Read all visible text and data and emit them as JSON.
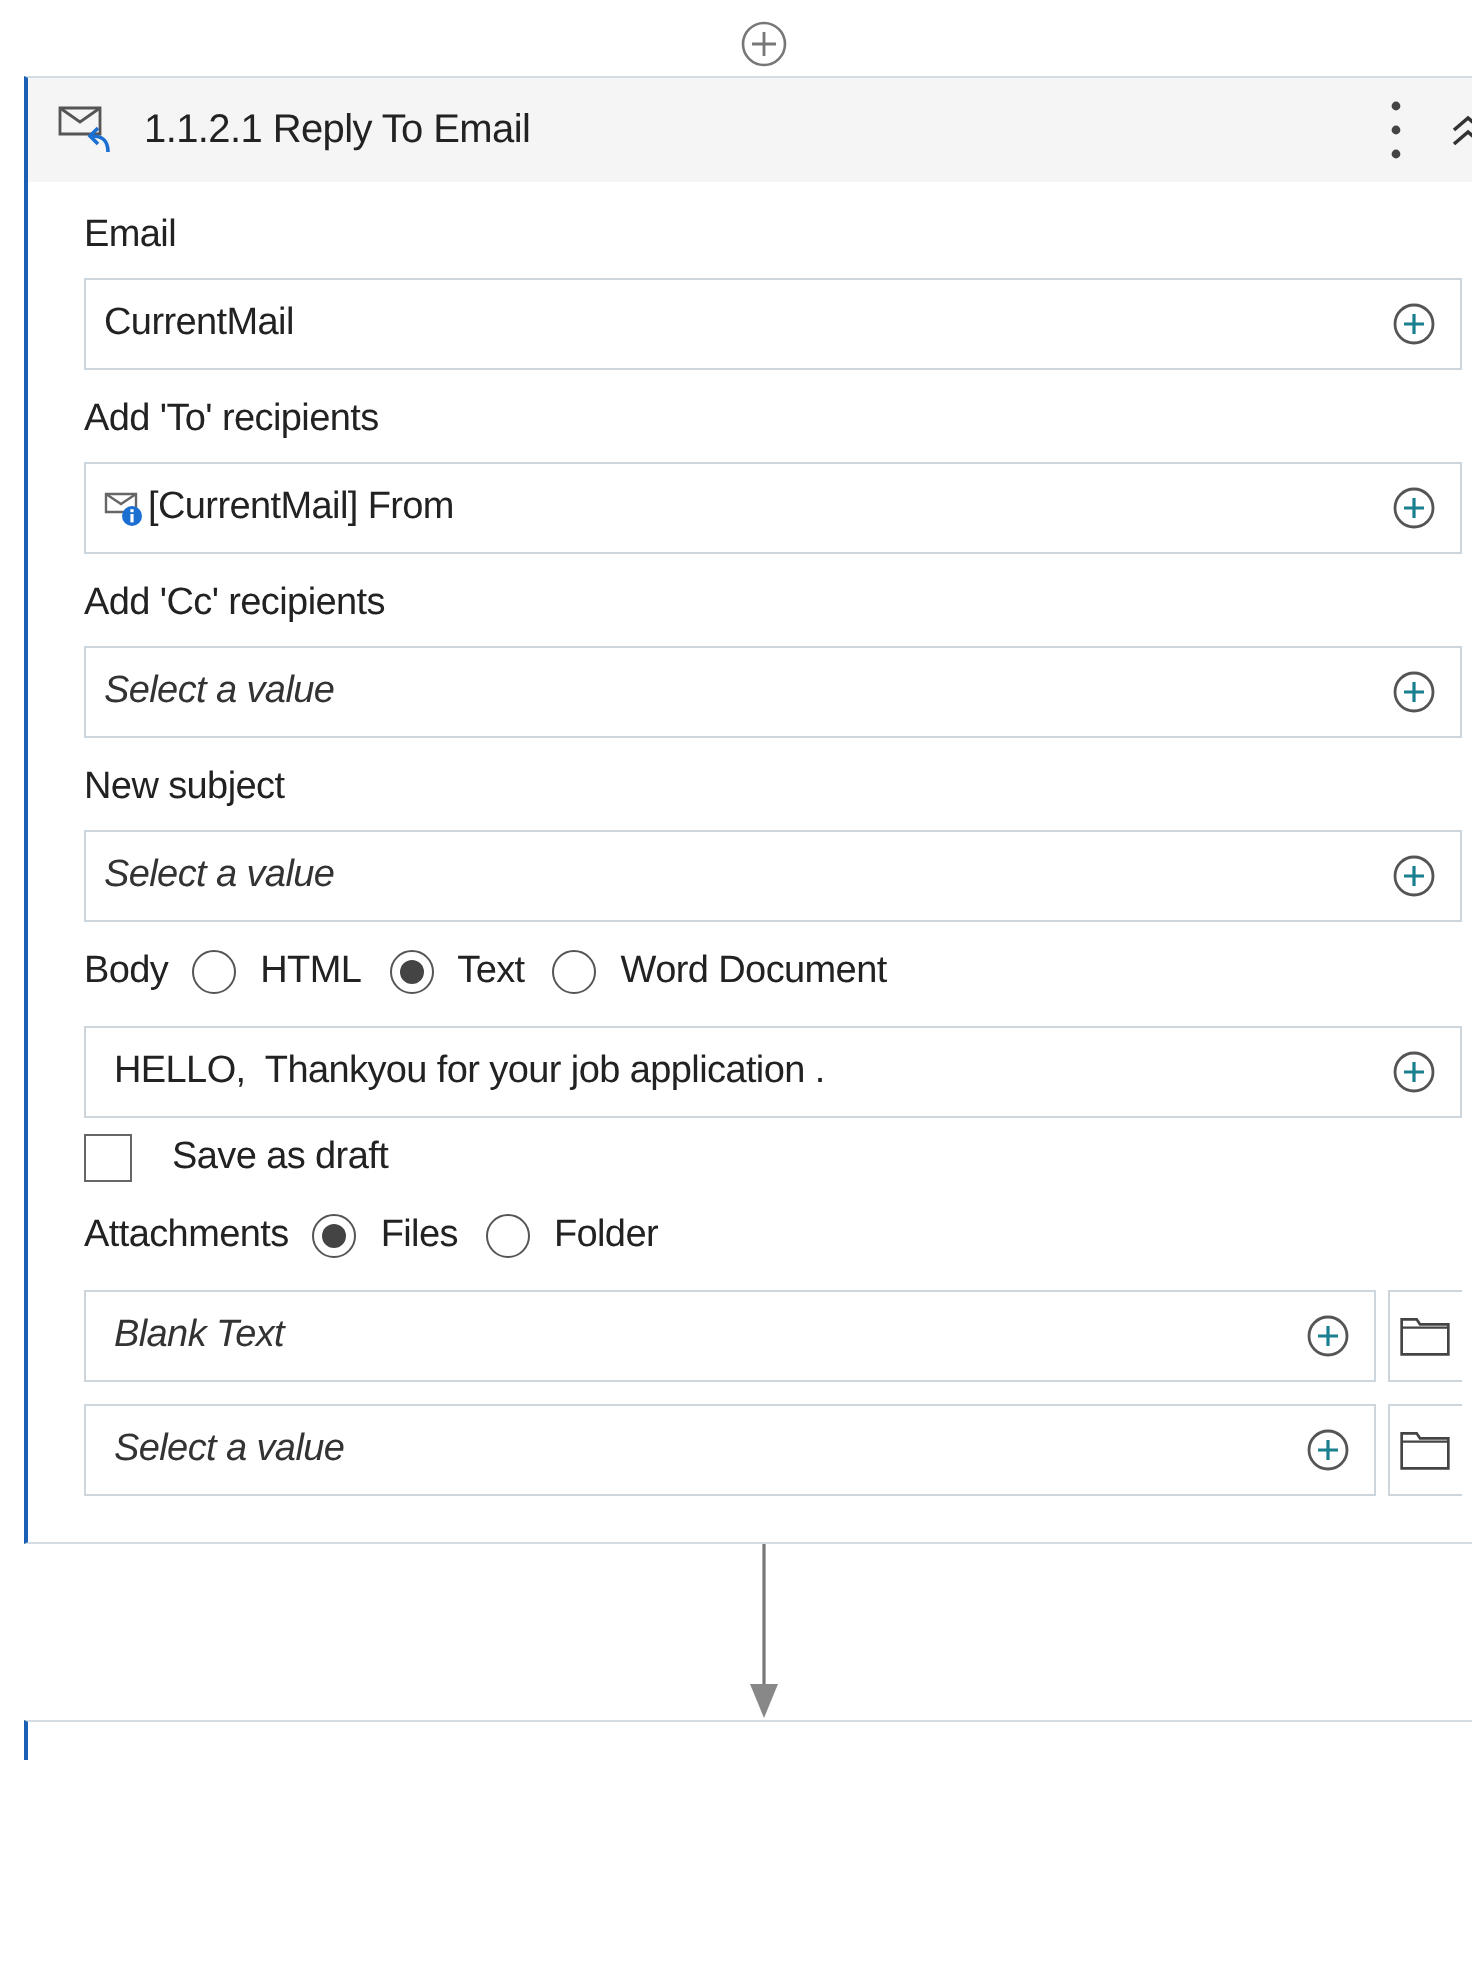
{
  "activity": {
    "title": "1.1.2.1 Reply To Email"
  },
  "fields": [
    {
      "kind": "input",
      "label": "Email",
      "value": "CurrentMail"
    },
    {
      "kind": "input",
      "label": "Add 'To' recipients",
      "value": "[CurrentMail] From",
      "variable_icon": true
    },
    {
      "kind": "input",
      "label": "Add 'Cc' recipients",
      "placeholder": "Select a value"
    },
    {
      "kind": "input",
      "label": "New subject",
      "placeholder": "Select a value"
    },
    {
      "kind": "radio",
      "label": "Body",
      "options": [
        {
          "label": "HTML",
          "selected": false
        },
        {
          "label": "Text",
          "selected": true
        },
        {
          "label": "Word Document",
          "selected": false
        }
      ]
    },
    {
      "kind": "input",
      "value": "HELLO,  Thankyou for your job application ."
    },
    {
      "kind": "checkbox",
      "label": "Save as draft",
      "checked": false
    },
    {
      "kind": "radio",
      "label": "Attachments",
      "options": [
        {
          "label": "Files",
          "selected": true
        },
        {
          "label": "Folder",
          "selected": false
        }
      ]
    },
    {
      "kind": "file",
      "placeholder": "Blank Text"
    },
    {
      "kind": "file",
      "placeholder": "Select a value"
    }
  ]
}
